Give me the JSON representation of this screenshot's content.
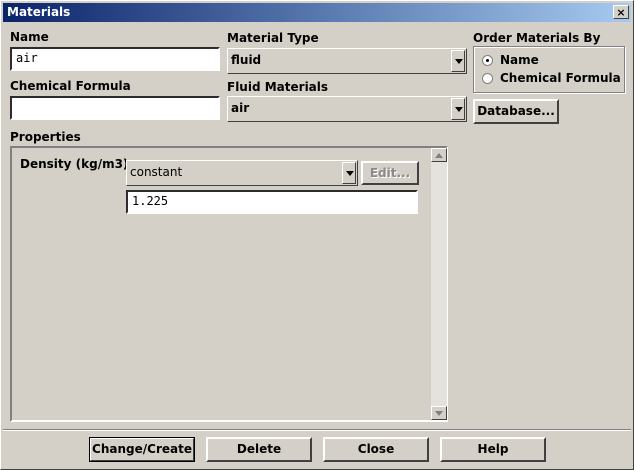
{
  "window": {
    "title": "Materials",
    "close_symbol": "×"
  },
  "name": {
    "label": "Name",
    "value": "air"
  },
  "chemical_formula": {
    "label": "Chemical Formula",
    "value": ""
  },
  "material_type": {
    "label": "Material Type",
    "value": "fluid"
  },
  "fluid_materials": {
    "label": "Fluid Materials",
    "value": "air"
  },
  "order_by": {
    "label": "Order Materials By",
    "options": [
      {
        "label": "Name",
        "selected": true
      },
      {
        "label": "Chemical Formula",
        "selected": false
      }
    ]
  },
  "database_button": "Database...",
  "properties": {
    "label": "Properties",
    "density": {
      "label": "Density (kg/m3)",
      "method": "constant",
      "edit_label": "Edit...",
      "value": "1.225"
    }
  },
  "buttons": {
    "change_create": "Change/Create",
    "delete": "Delete",
    "close": "Close",
    "help": "Help"
  }
}
